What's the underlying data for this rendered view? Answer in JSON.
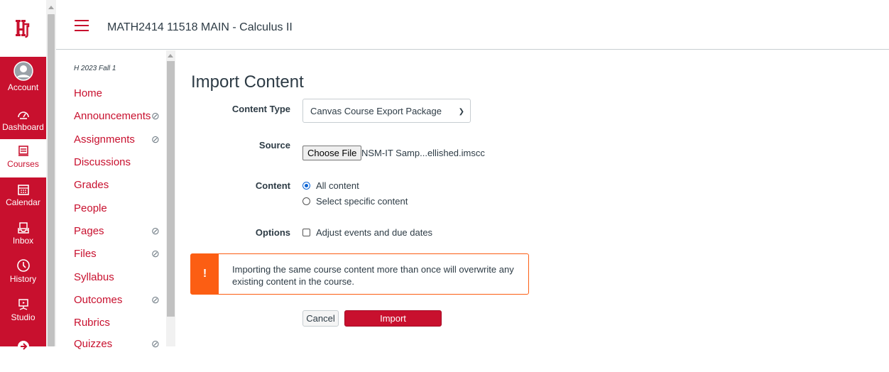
{
  "colors": {
    "brand": "#c8102e",
    "warning": "#fc5e13"
  },
  "global_nav": {
    "items": [
      {
        "label": "Account",
        "icon": "account-icon"
      },
      {
        "label": "Dashboard",
        "icon": "dashboard-icon"
      },
      {
        "label": "Courses",
        "icon": "courses-icon",
        "active": true
      },
      {
        "label": "Calendar",
        "icon": "calendar-icon"
      },
      {
        "label": "Inbox",
        "icon": "inbox-icon"
      },
      {
        "label": "History",
        "icon": "history-icon"
      },
      {
        "label": "Studio",
        "icon": "studio-icon"
      }
    ]
  },
  "header": {
    "course_title": "MATH2414 11518 MAIN - Calculus II"
  },
  "course_nav": {
    "term": "H 2023 Fall 1",
    "items": [
      {
        "label": "Home",
        "hidden": false
      },
      {
        "label": "Announcements",
        "hidden": true
      },
      {
        "label": "Assignments",
        "hidden": true
      },
      {
        "label": "Discussions",
        "hidden": false
      },
      {
        "label": "Grades",
        "hidden": false
      },
      {
        "label": "People",
        "hidden": false
      },
      {
        "label": "Pages",
        "hidden": true
      },
      {
        "label": "Files",
        "hidden": true
      },
      {
        "label": "Syllabus",
        "hidden": false
      },
      {
        "label": "Outcomes",
        "hidden": true
      },
      {
        "label": "Rubrics",
        "hidden": false
      },
      {
        "label": "Quizzes",
        "hidden": true
      }
    ]
  },
  "main": {
    "title": "Import Content",
    "content_type_label": "Content Type",
    "content_type_value": "Canvas Course Export Package",
    "source_label": "Source",
    "choose_file_label": "Choose File",
    "file_name": "NSM-IT Samp...ellished.imscc",
    "content_label": "Content",
    "content_options": [
      "All content",
      "Select specific content"
    ],
    "options_label": "Options",
    "adjust_dates_label": "Adjust events and due dates",
    "alert_icon": "!",
    "alert_message": "Importing the same course content more than once will overwrite any existing content in the course.",
    "cancel_label": "Cancel",
    "import_label": "Import"
  }
}
